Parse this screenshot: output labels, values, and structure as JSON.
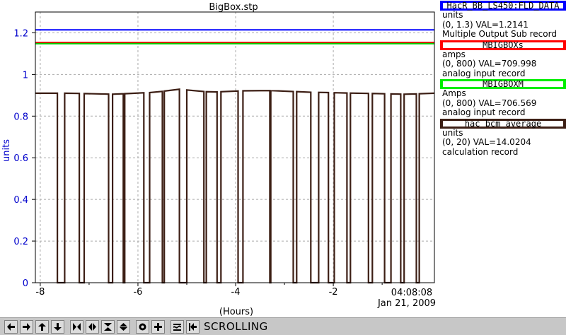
{
  "chart_data": {
    "type": "line",
    "title": "BigBox.stp",
    "ylabel": "units",
    "xlabel": "(Hours)",
    "xlim": [
      -8.1,
      0.07
    ],
    "ylim": [
      0,
      1.3
    ],
    "y_ticks": [
      "0",
      "0.2",
      "0.4",
      "0.6",
      "0.8",
      "1",
      "1.2"
    ],
    "x_ticks": [
      "-8",
      "-6",
      "-4",
      "-2"
    ],
    "end_time": "04:08:08",
    "end_date": "Jan 21, 2009",
    "grid": true,
    "series": [
      {
        "name": "HacR_BB_LS450:FLD_DATA",
        "color": "#0000ff",
        "constant": 1.2141
      },
      {
        "name": "MBIGBOXs",
        "color": "#ff0000",
        "constant": 1.1539
      },
      {
        "name": "MBIGBOXM",
        "color": "#00cc00",
        "constant": 1.1482
      },
      {
        "name": "hac_bcm_average",
        "color": "#3c1e14",
        "baseline": [
          [
            -8.1,
            0.91
          ],
          [
            -7.4,
            0.91
          ],
          [
            -6.5,
            0.905
          ],
          [
            -5.6,
            0.915
          ],
          [
            -5.2,
            0.93
          ],
          [
            -4.5,
            0.915
          ],
          [
            -3.5,
            0.925
          ],
          [
            -2.5,
            0.915
          ],
          [
            -1.5,
            0.91
          ],
          [
            -0.5,
            0.905
          ],
          [
            0.07,
            0.91
          ]
        ],
        "dropouts": [
          [
            -7.65,
            -7.5
          ],
          [
            -7.2,
            -7.1
          ],
          [
            -6.6,
            -6.52
          ],
          [
            -6.3,
            -6.27
          ],
          [
            -5.88,
            -5.76
          ],
          [
            -5.5,
            -5.46
          ],
          [
            -5.15,
            -5.0
          ],
          [
            -4.65,
            -4.6
          ],
          [
            -4.38,
            -4.3
          ],
          [
            -3.95,
            -3.85
          ],
          [
            -3.3,
            -3.28
          ],
          [
            -2.82,
            -2.75
          ],
          [
            -2.46,
            -2.3
          ],
          [
            -2.1,
            -1.98
          ],
          [
            -1.72,
            -1.65
          ],
          [
            -1.28,
            -1.2
          ],
          [
            -0.95,
            -0.82
          ],
          [
            -0.62,
            -0.55
          ],
          [
            -0.3,
            -0.24
          ]
        ]
      }
    ]
  },
  "legend": [
    {
      "name": "HacR_BB_LS450:FLD_DATA",
      "color": "#0000ff",
      "units": "units",
      "range": "(0, 1.3) VAL=1.2141",
      "record": "Multiple Output Sub record"
    },
    {
      "name": "MBIGBOXs",
      "color": "#ff0000",
      "units": "amps",
      "range": "(0, 800) VAL=709.998",
      "record": "analog input record"
    },
    {
      "name": "MBIGBOXM",
      "color": "#00ee00",
      "units": "Amps",
      "range": "(0, 800) VAL=706.569",
      "record": "analog input record"
    },
    {
      "name": "hac_bcm_average",
      "color": "#3c1e14",
      "units": "units",
      "range": "(0, 20) VAL=14.0204",
      "record": "calculation record"
    }
  ],
  "toolbar": {
    "buttons": [
      "arrow-left-icon",
      "arrow-right-icon",
      "arrow-up-icon",
      "arrow-down-icon",
      "expand-horizontal-icon",
      "compress-horizontal-icon",
      "expand-vertical-icon",
      "compress-vertical-icon",
      "record-icon",
      "plus-icon",
      "scroll-mode-icon",
      "jump-end-icon"
    ],
    "status": "SCROLLING"
  }
}
